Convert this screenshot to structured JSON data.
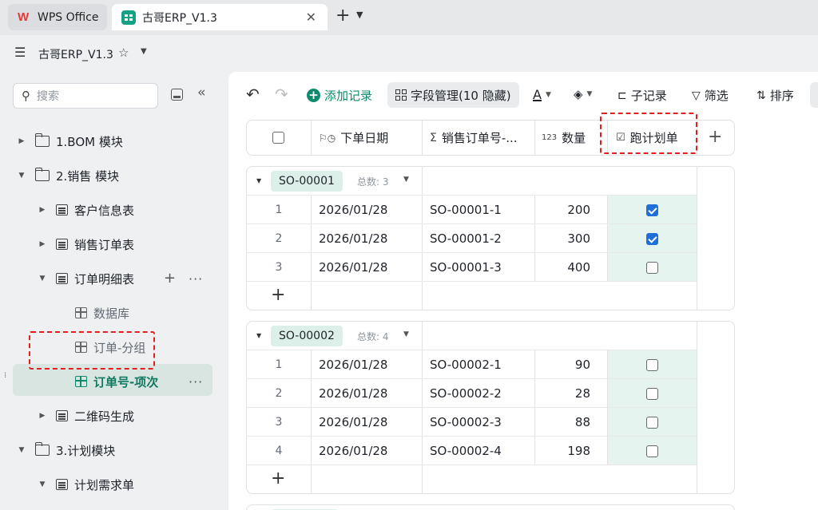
{
  "tabs": {
    "wps_label": "WPS Office",
    "erp_label": "古哥ERP_V1.3",
    "close": "✕",
    "add": "+",
    "more": "⌄"
  },
  "header": {
    "title": "古哥ERP_V1.3"
  },
  "sidebar": {
    "search_placeholder": "搜索",
    "items": [
      {
        "label": "1.BOM 模块",
        "kind": "folder",
        "expanded": false
      },
      {
        "label": "2.销售 模块",
        "kind": "folder",
        "expanded": true
      },
      {
        "label": "客户信息表",
        "kind": "sheet",
        "expanded": false
      },
      {
        "label": "销售订单表",
        "kind": "sheet",
        "expanded": false
      },
      {
        "label": "订单明细表",
        "kind": "sheet",
        "expanded": true
      },
      {
        "label": "数据库",
        "kind": "view"
      },
      {
        "label": "订单-分组",
        "kind": "view"
      },
      {
        "label": "订单号-项次",
        "kind": "view",
        "active": true
      },
      {
        "label": "二维码生成",
        "kind": "sheet",
        "expanded": false
      },
      {
        "label": "3.计划模块",
        "kind": "folder",
        "expanded": true
      },
      {
        "label": "计划需求单",
        "kind": "sheet",
        "expanded": true
      }
    ]
  },
  "toolbar": {
    "add_record": "添加记录",
    "field_manage": "字段管理(10 隐藏)",
    "text_style": "A",
    "sub_record": "子记录",
    "filter": "筛选",
    "sort": "排序"
  },
  "columns": {
    "order_date": "下单日期",
    "so_no": "销售订单号-...",
    "qty_prefix": "123",
    "qty": "数量",
    "plan": "跑计划单"
  },
  "groups": [
    {
      "tag": "SO-00001",
      "count_label": "总数: 3",
      "rows": [
        {
          "idx": "1",
          "date": "2026/01/28",
          "so": "SO-00001-1",
          "qty": "200",
          "checked": true
        },
        {
          "idx": "2",
          "date": "2026/01/28",
          "so": "SO-00001-2",
          "qty": "300",
          "checked": true
        },
        {
          "idx": "3",
          "date": "2026/01/28",
          "so": "SO-00001-3",
          "qty": "400",
          "checked": false
        }
      ]
    },
    {
      "tag": "SO-00002",
      "count_label": "总数: 4",
      "rows": [
        {
          "idx": "1",
          "date": "2026/01/28",
          "so": "SO-00002-1",
          "qty": "90",
          "checked": false
        },
        {
          "idx": "2",
          "date": "2026/01/28",
          "so": "SO-00002-2",
          "qty": "28",
          "checked": false
        },
        {
          "idx": "3",
          "date": "2026/01/28",
          "so": "SO-00002-3",
          "qty": "88",
          "checked": false
        },
        {
          "idx": "4",
          "date": "2026/01/28",
          "so": "SO-00002-4",
          "qty": "198",
          "checked": false
        }
      ]
    }
  ],
  "colors": {
    "accent": "#0f8a6c",
    "checkbox_checked": "#1e6fd9",
    "highlight_dash": "#e02020",
    "plan_column_bg": "#e6f4f0"
  }
}
